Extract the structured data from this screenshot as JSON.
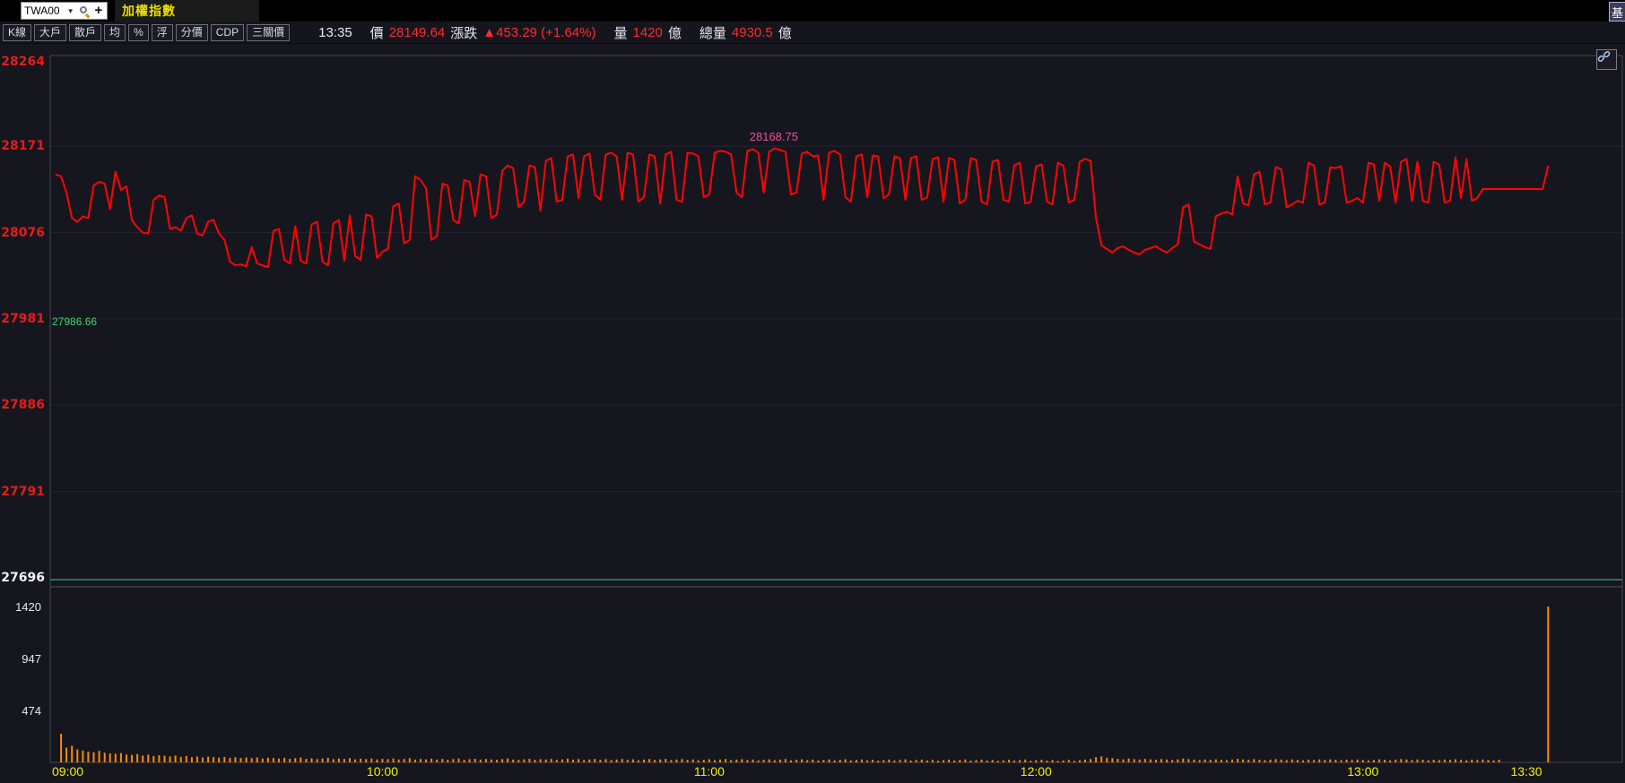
{
  "window": {
    "symbol_input": "TWA00",
    "tab_title": "加權指數",
    "corner_button": "基"
  },
  "icons": {
    "dropdown": "▼",
    "add": "+"
  },
  "toolbar": {
    "buttons": [
      "K線",
      "大戶",
      "散戶",
      "均",
      "%",
      "浮",
      "分價",
      "CDP",
      "三關價"
    ]
  },
  "status": {
    "time": "13:35",
    "price_label": "價",
    "price": "28149.64",
    "change_label": "漲跌",
    "change": "▲453.29 (+1.64%)",
    "volume_label": "量",
    "volume": "1420",
    "volume_unit": "億",
    "total_volume_label": "總量",
    "total_volume": "4930.5",
    "total_volume_unit": "億"
  },
  "chart": {
    "high_label": "28168.75",
    "prev_close_label": "27986.66"
  },
  "chart_data": {
    "type": "line",
    "title": "TWA00 加權指數 intraday 1-min price and volume",
    "x_axis": {
      "labels": [
        "09:00",
        "10:00",
        "11:00",
        "12:00",
        "13:00",
        "13:30"
      ],
      "minutes": [
        0,
        60,
        120,
        180,
        240,
        270
      ]
    },
    "price_axis": {
      "ticks": [
        28264,
        28171,
        28076,
        27981,
        27886,
        27791,
        27696
      ],
      "range": [
        27696,
        28264
      ]
    },
    "volume_axis": {
      "ticks": [
        1420,
        947,
        474
      ],
      "range": [
        0,
        1420
      ]
    },
    "prev_close": 27986.66,
    "day_high": 28168.75,
    "high_minute": 132,
    "last_price": 28149.64,
    "session_minutes": 274,
    "price_color": "#ff0404",
    "volume_color": "#ff8a00",
    "prices": [
      28140,
      28138,
      28120,
      28092,
      28088,
      28094,
      28092,
      28128,
      28132,
      28130,
      28102,
      28143,
      28123,
      28127,
      28090,
      28082,
      28076,
      28075,
      28112,
      28117,
      28115,
      28080,
      28082,
      28078,
      28092,
      28095,
      28075,
      28073,
      28088,
      28090,
      28075,
      28068,
      28044,
      28040,
      28041,
      28039,
      28060,
      28042,
      28040,
      28038,
      28078,
      28080,
      28046,
      28042,
      28083,
      28045,
      28042,
      28085,
      28088,
      28044,
      28040,
      28086,
      28090,
      28045,
      28095,
      28050,
      28046,
      28096,
      28094,
      28048,
      28055,
      28058,
      28105,
      28108,
      28064,
      28068,
      28138,
      28134,
      28125,
      28068,
      28072,
      28130,
      28128,
      28090,
      28086,
      28134,
      28132,
      28094,
      28140,
      28138,
      28092,
      28096,
      28144,
      28150,
      28147,
      28104,
      28110,
      28150,
      28148,
      28100,
      28155,
      28158,
      28110,
      28112,
      28160,
      28162,
      28114,
      28160,
      28163,
      28118,
      28112,
      28162,
      28164,
      28160,
      28112,
      28164,
      28162,
      28110,
      28115,
      28162,
      28160,
      28108,
      28162,
      28165,
      28112,
      28110,
      28164,
      28163,
      28160,
      28115,
      28118,
      28164,
      28166,
      28165,
      28162,
      28120,
      28115,
      28166,
      28168,
      28164,
      28120,
      28165,
      28168.75,
      28167,
      28165,
      28118,
      28120,
      28163,
      28165,
      28160,
      28161,
      28112,
      28164,
      28166,
      28162,
      28115,
      28110,
      28160,
      28162,
      28115,
      28161,
      28160,
      28114,
      28118,
      28160,
      28158,
      28112,
      28158,
      28160,
      28112,
      28115,
      28157,
      28159,
      28110,
      28158,
      28156,
      28108,
      28112,
      28158,
      28156,
      28110,
      28107,
      28154,
      28156,
      28112,
      28110,
      28150,
      28153,
      28108,
      28110,
      28149,
      28151,
      28110,
      28107,
      28153,
      28150,
      28109,
      28112,
      28154,
      28157,
      28155,
      28092,
      28062,
      28058,
      28054,
      28059,
      28061,
      28057,
      28054,
      28052,
      28057,
      28059,
      28061,
      28057,
      28054,
      28059,
      28063,
      28104,
      28107,
      28066,
      28063,
      28060,
      28058,
      28094,
      28097,
      28099,
      28096,
      28138,
      28108,
      28106,
      28140,
      28143,
      28107,
      28109,
      28148,
      28146,
      28104,
      28107,
      28111,
      28109,
      28153,
      28150,
      28107,
      28109,
      28148,
      28147,
      28149,
      28109,
      28111,
      28114,
      28109,
      28153,
      28151,
      28111,
      28153,
      28149,
      28109,
      28154,
      28157,
      28111,
      28154,
      28111,
      28109,
      28154,
      28151,
      28109,
      28111,
      28159,
      28114,
      28157,
      28111,
      28114,
      28124,
      28124,
      28124,
      28124,
      28124,
      28124,
      28124,
      28124,
      28124,
      28124,
      28124,
      28124,
      28149.64
    ],
    "volumes": [
      0,
      260,
      135,
      150,
      118,
      108,
      98,
      92,
      105,
      88,
      82,
      78,
      85,
      72,
      68,
      75,
      62,
      70,
      58,
      65,
      60,
      55,
      62,
      50,
      58,
      47,
      54,
      45,
      52,
      48,
      44,
      50,
      42,
      47,
      40,
      45,
      38,
      44,
      36,
      42,
      40,
      35,
      42,
      33,
      38,
      45,
      32,
      37,
      30,
      36,
      42,
      29,
      35,
      31,
      38,
      28,
      34,
      30,
      36,
      27,
      33,
      30,
      36,
      26,
      32,
      38,
      25,
      31,
      28,
      34,
      26,
      32,
      24,
      30,
      35,
      23,
      29,
      33,
      25,
      31,
      27,
      24,
      30,
      36,
      26,
      22,
      28,
      33,
      24,
      29,
      26,
      31,
      23,
      28,
      34,
      25,
      30,
      22,
      27,
      32,
      24,
      29,
      21,
      26,
      31,
      23,
      28,
      20,
      25,
      30,
      22,
      27,
      32,
      21,
      26,
      30,
      22,
      27,
      19,
      24,
      29,
      21,
      26,
      31,
      20,
      25,
      29,
      21,
      26,
      18,
      23,
      28,
      20,
      25,
      30,
      19,
      24,
      28,
      20,
      25,
      17,
      22,
      27,
      19,
      24,
      29,
      18,
      23,
      27,
      19,
      24,
      16,
      21,
      26,
      18,
      23,
      28,
      17,
      22,
      26,
      18,
      23,
      15,
      20,
      25,
      17,
      22,
      27,
      16,
      21,
      25,
      17,
      22,
      14,
      19,
      24,
      16,
      21,
      26,
      15,
      20,
      24,
      16,
      21,
      13,
      18,
      23,
      15,
      20,
      25,
      30,
      48,
      55,
      42,
      38,
      33,
      28,
      35,
      30,
      26,
      32,
      28,
      24,
      30,
      26,
      22,
      28,
      35,
      30,
      25,
      21,
      26,
      22,
      28,
      24,
      20,
      26,
      32,
      27,
      23,
      29,
      24,
      20,
      25,
      30,
      26,
      21,
      27,
      23,
      19,
      25,
      21,
      27,
      22,
      28,
      24,
      20,
      25,
      21,
      26,
      22,
      18,
      23,
      28,
      24,
      19,
      25,
      30,
      26,
      21,
      27,
      23,
      19,
      24,
      20,
      26,
      22,
      28,
      23,
      19,
      25,
      21,
      26,
      22,
      18,
      24,
      0,
      0,
      0,
      0,
      0,
      0,
      0,
      0,
      1420
    ]
  }
}
